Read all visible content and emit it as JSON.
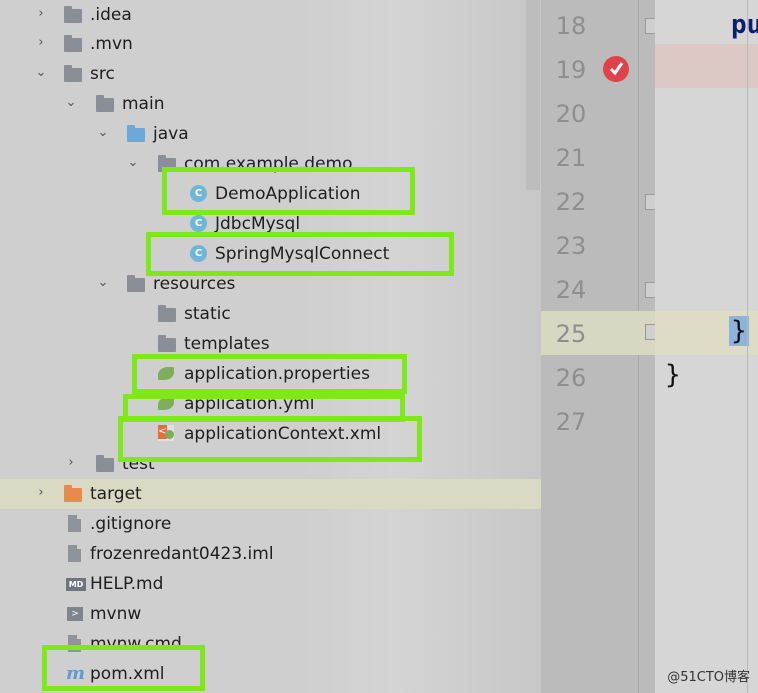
{
  "project_tree": {
    "items": [
      {
        "label": ".idea",
        "arrow": "›",
        "icon": "folder-icon"
      },
      {
        "label": ".mvn",
        "arrow": "›",
        "icon": "folder-icon"
      },
      {
        "label": "src",
        "arrow": "⌄",
        "icon": "folder-icon"
      },
      {
        "label": "main",
        "arrow": "⌄",
        "icon": "folder-icon"
      },
      {
        "label": "java",
        "arrow": "⌄",
        "icon": "source-folder-icon"
      },
      {
        "label": "com.example.demo",
        "arrow": "⌄",
        "icon": "package-icon"
      },
      {
        "label": "DemoApplication",
        "icon": "spring-boot-class-icon",
        "icon_text": "C"
      },
      {
        "label": "JdbcMysql",
        "icon": "java-class-icon",
        "icon_text": "C"
      },
      {
        "label": "SpringMysqlConnect",
        "icon": "java-class-icon",
        "icon_text": "C"
      },
      {
        "label": "resources",
        "arrow": "⌄",
        "icon": "resources-folder-icon"
      },
      {
        "label": "static",
        "icon": "folder-icon"
      },
      {
        "label": "templates",
        "icon": "folder-icon"
      },
      {
        "label": "application.properties",
        "icon": "spring-properties-icon"
      },
      {
        "label": "application.yml",
        "icon": "spring-yml-icon"
      },
      {
        "label": "applicationContext.xml",
        "icon": "spring-xml-icon"
      },
      {
        "label": "test",
        "arrow": "›",
        "icon": "folder-icon"
      },
      {
        "label": "target",
        "arrow": "›",
        "icon": "excluded-folder-icon"
      },
      {
        "label": ".gitignore",
        "icon": "file-icon"
      },
      {
        "label": "frozenredant0423.iml",
        "icon": "module-file-icon"
      },
      {
        "label": "HELP.md",
        "icon": "markdown-icon",
        "icon_text": "MD"
      },
      {
        "label": "mvnw",
        "icon": "terminal-icon",
        "icon_text": ">"
      },
      {
        "label": "mvnw.cmd",
        "icon": "cmd-file-icon"
      },
      {
        "label": "pom.xml",
        "icon": "maven-icon",
        "icon_text": "m"
      }
    ]
  },
  "gutter": {
    "line_numbers": [
      "18",
      "19",
      "20",
      "21",
      "22",
      "23",
      "24",
      "25",
      "26",
      "27"
    ]
  },
  "editor": {
    "keyword_fragment": "pu",
    "brace_line25": "}",
    "brace_line26": "}"
  },
  "watermark": "@51CTO博客",
  "colors": {
    "highlight_box": "#7ee81a",
    "class_icon": "#6fb6d9",
    "spring_green": "#7fae5a",
    "excluded_folder": "#e88a4c"
  }
}
